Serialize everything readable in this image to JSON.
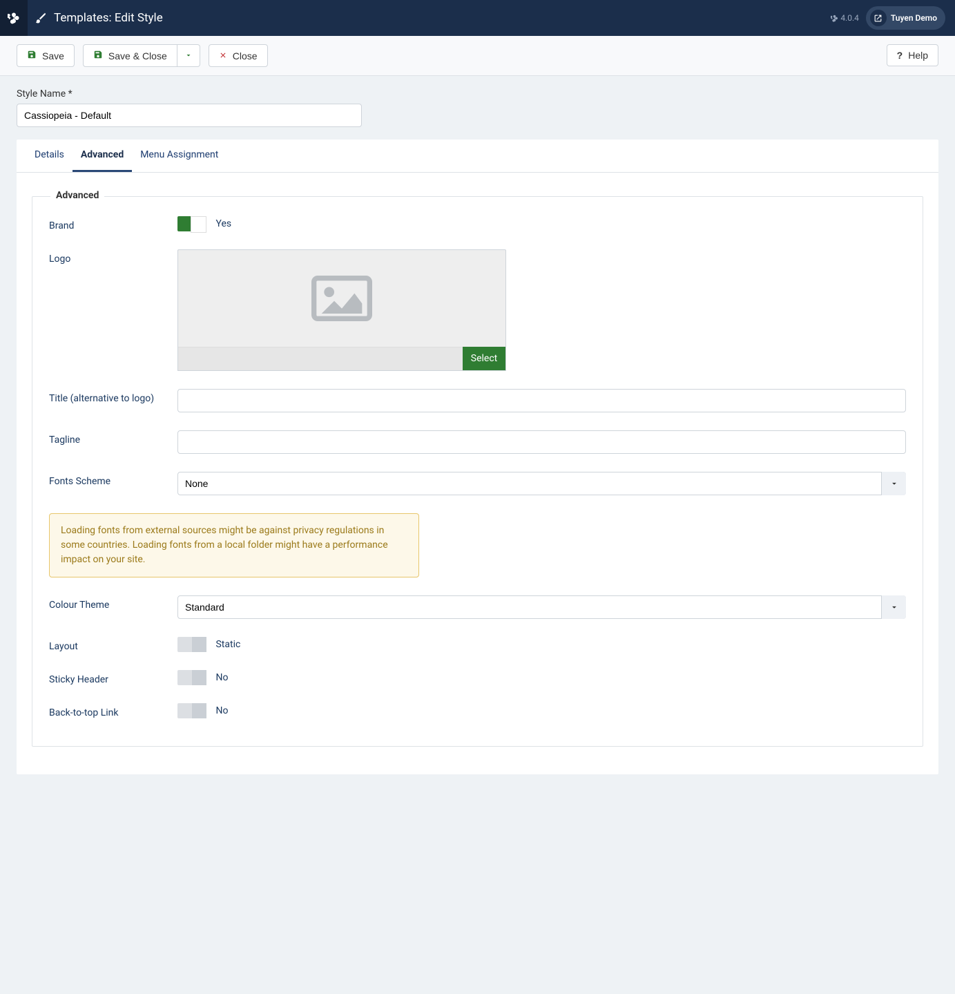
{
  "header": {
    "title": "Templates: Edit Style",
    "version": "4.0.4",
    "user": "Tuyen Demo"
  },
  "toolbar": {
    "save": "Save",
    "save_close": "Save & Close",
    "close": "Close",
    "help": "Help"
  },
  "style_name": {
    "label": "Style Name *",
    "value": "Cassiopeia - Default"
  },
  "tabs": {
    "details": "Details",
    "advanced": "Advanced",
    "menu_assignment": "Menu Assignment"
  },
  "fieldset": {
    "legend": "Advanced",
    "brand": {
      "label": "Brand",
      "value": "Yes"
    },
    "logo": {
      "label": "Logo",
      "select": "Select"
    },
    "title_alt": {
      "label": "Title (alternative to logo)",
      "value": ""
    },
    "tagline": {
      "label": "Tagline",
      "value": ""
    },
    "fonts_scheme": {
      "label": "Fonts Scheme",
      "value": "None"
    },
    "alert": "Loading fonts from external sources might be against privacy regulations in some countries. Loading fonts from a local folder might have a performance impact on your site.",
    "colour_theme": {
      "label": "Colour Theme",
      "value": "Standard"
    },
    "layout": {
      "label": "Layout",
      "value": "Static"
    },
    "sticky_header": {
      "label": "Sticky Header",
      "value": "No"
    },
    "back_to_top": {
      "label": "Back-to-top Link",
      "value": "No"
    }
  }
}
